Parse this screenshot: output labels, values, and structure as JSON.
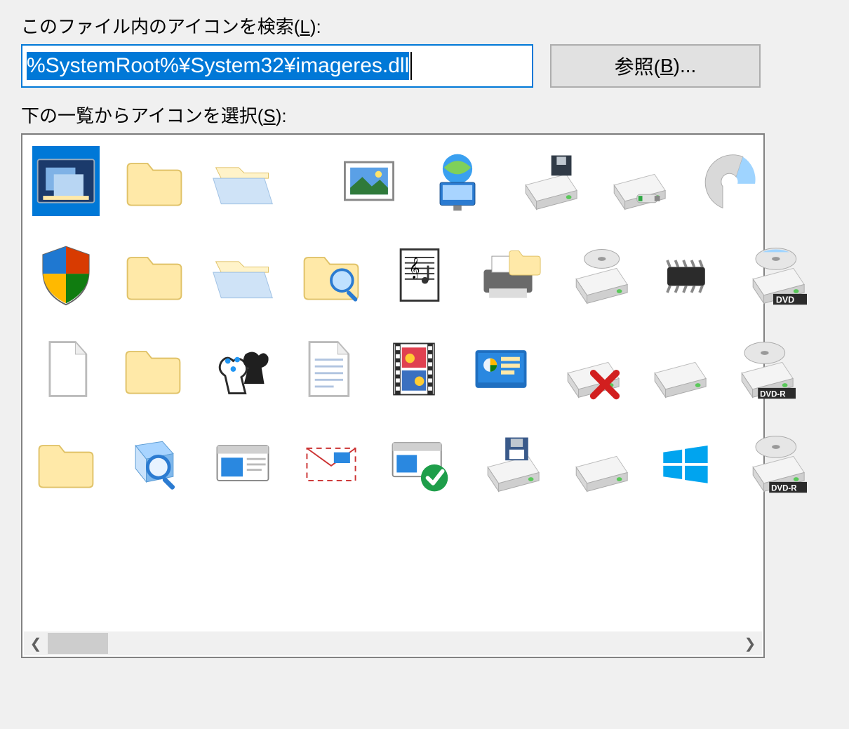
{
  "labels": {
    "search_prefix": "このファイル内のアイコンを検索(",
    "search_acc": "L",
    "search_suffix": "):",
    "select_prefix": "下の一覧からアイコンを選択(",
    "select_acc": "S",
    "select_suffix": "):"
  },
  "path": {
    "value": "%SystemRoot%¥System32¥imageres.dll"
  },
  "browse": {
    "prefix": "参照(",
    "acc": "B",
    "suffix": ")..."
  },
  "icons": {
    "selected_index": 0,
    "rows": [
      [
        "window-stack",
        "folder",
        "folder-open",
        "blank",
        "picture",
        "network-globe",
        "drive-floppy",
        "drive-usb",
        "disc-partial"
      ],
      [
        "shield-security",
        "folder",
        "folder-open",
        "folder-search",
        "music-sheet",
        "printer-folder",
        "disc-eject",
        "chip",
        "dvd-drive"
      ],
      [
        "document-blank",
        "folder",
        "game-pieces",
        "text-document",
        "video-clip",
        "program-default",
        "drive-error",
        "drive",
        "dvdr-drive"
      ],
      [
        "folder",
        "search-3d",
        "window",
        "envelope",
        "window-checked",
        "drive-save",
        "drive",
        "windows-logo",
        "dvdr-drive"
      ]
    ]
  },
  "scrollbar": {
    "left_arrow": "❮",
    "right_arrow": "❯"
  }
}
